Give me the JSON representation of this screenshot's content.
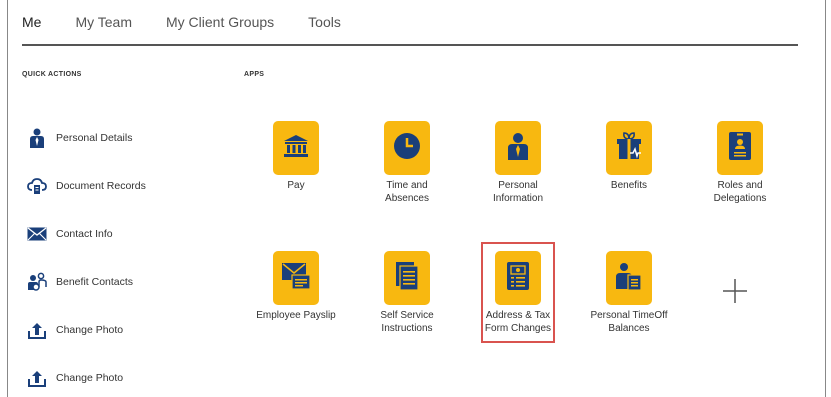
{
  "tabs": [
    "Me",
    "My Team",
    "My Client Groups",
    "Tools"
  ],
  "sections": {
    "quick_actions": "QUICK ACTIONS",
    "apps": "APPS"
  },
  "quick_actions": [
    {
      "label": "Personal Details",
      "icon": "person-icon"
    },
    {
      "label": "Document Records",
      "icon": "document-cloud-icon"
    },
    {
      "label": "Contact Info",
      "icon": "envelope-icon"
    },
    {
      "label": "Benefit Contacts",
      "icon": "group-contacts-icon"
    },
    {
      "label": "Change Photo",
      "icon": "upload-icon"
    },
    {
      "label": "Change Photo",
      "icon": "upload-icon"
    }
  ],
  "apps": [
    {
      "label": "Pay",
      "icon": "bank-icon"
    },
    {
      "label": "Time and\nAbsences",
      "icon": "clock-icon"
    },
    {
      "label": "Personal\nInformation",
      "icon": "person-icon"
    },
    {
      "label": "Benefits",
      "icon": "gift-icon"
    },
    {
      "label": "Roles and\nDelegations",
      "icon": "id-badge-icon"
    },
    {
      "label": "Employee Payslip",
      "icon": "payslip-envelope-icon"
    },
    {
      "label": "Self Service\nInstructions",
      "icon": "documents-icon"
    },
    {
      "label": "Address & Tax\nForm Changes",
      "icon": "tax-form-icon"
    },
    {
      "label": "Personal TimeOff\nBalances",
      "icon": "person-document-icon"
    }
  ],
  "add_app_icon": "plus-icon",
  "colors": {
    "tile": "#f8b810",
    "icon_blue": "#1a3f7a",
    "highlight": "#d9534f"
  }
}
